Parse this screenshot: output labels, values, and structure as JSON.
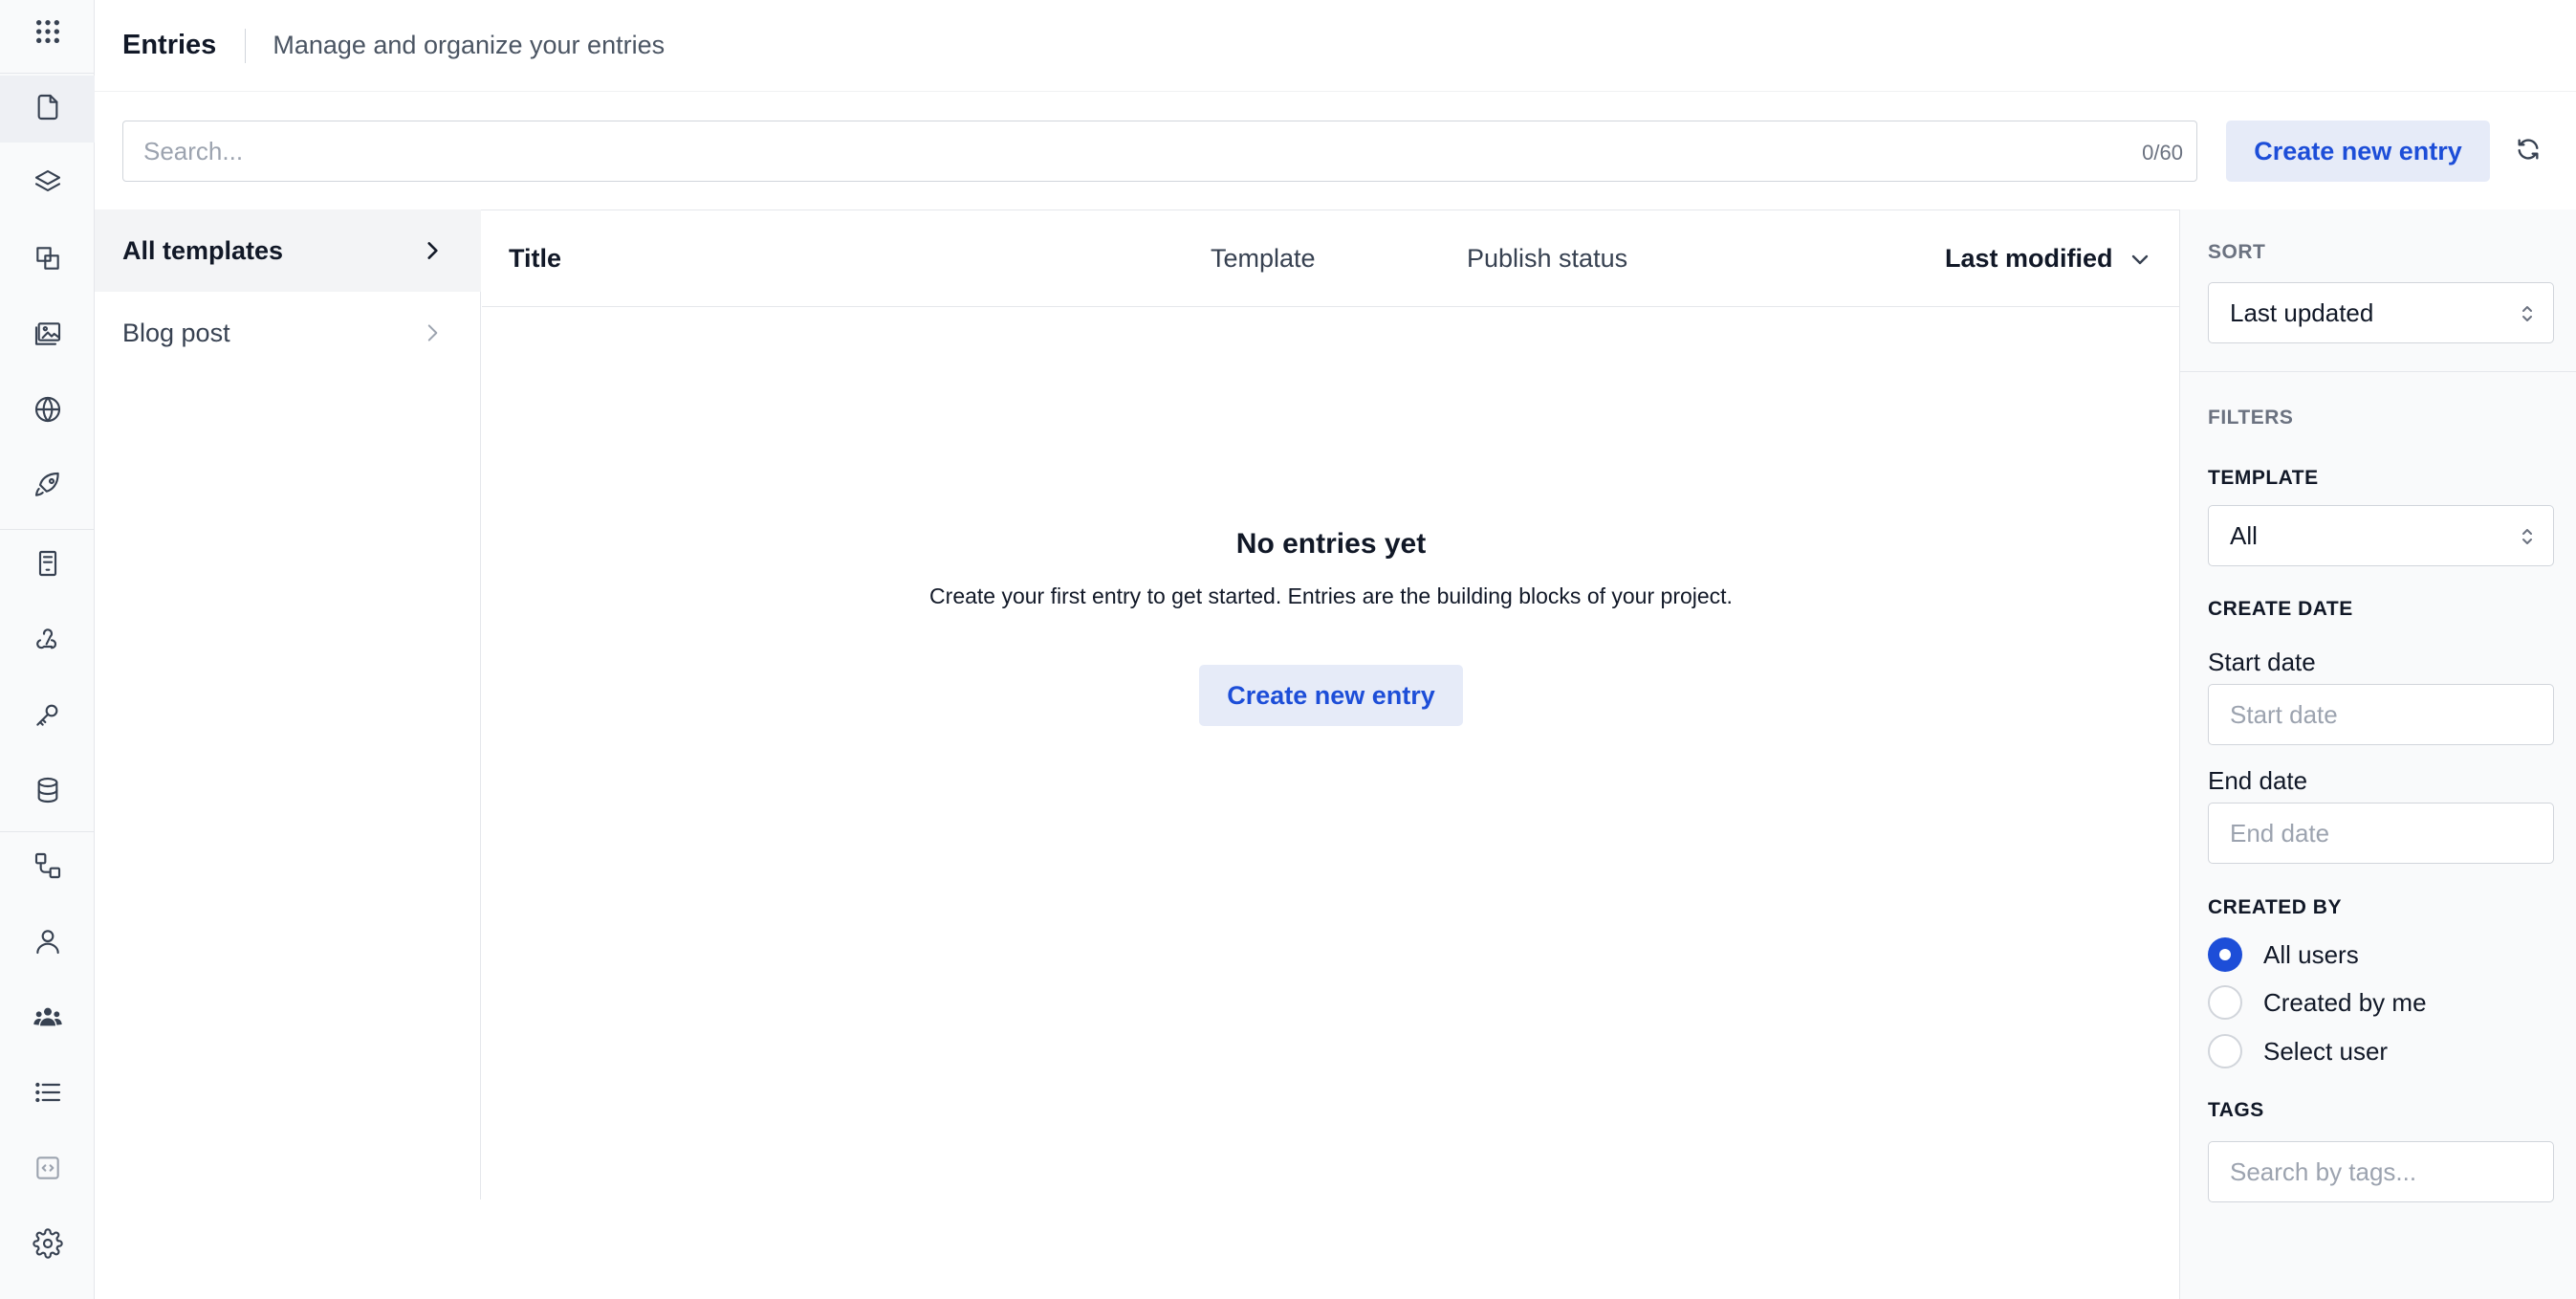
{
  "header": {
    "title": "Entries",
    "subtitle": "Manage and organize your entries"
  },
  "search": {
    "placeholder": "Search...",
    "value": "",
    "counter": "0/60"
  },
  "actions": {
    "create_label": "Create new entry"
  },
  "rail": {
    "items": [
      {
        "icon": "grid-icon"
      },
      {
        "icon": "document-icon",
        "active": true
      },
      {
        "icon": "layers-icon"
      },
      {
        "icon": "shapes-icon"
      },
      {
        "icon": "images-icon"
      },
      {
        "icon": "globe-icon"
      },
      {
        "icon": "rocket-icon"
      },
      {
        "icon": "receipt-icon"
      },
      {
        "icon": "webhook-icon"
      },
      {
        "icon": "key-icon"
      },
      {
        "icon": "database-icon"
      },
      {
        "icon": "workflow-icon"
      },
      {
        "icon": "user-icon"
      },
      {
        "icon": "users-icon"
      },
      {
        "icon": "list-icon"
      },
      {
        "icon": "code-icon"
      },
      {
        "icon": "gear-icon"
      }
    ]
  },
  "templates": {
    "items": [
      {
        "label": "All templates",
        "active": true
      },
      {
        "label": "Blog post",
        "active": false
      }
    ]
  },
  "table": {
    "columns": {
      "title": "Title",
      "template": "Template",
      "status": "Publish status",
      "modified": "Last modified"
    },
    "rows": []
  },
  "empty_state": {
    "heading": "No entries yet",
    "description": "Create your first entry to get started. Entries are the building blocks of your project.",
    "button": "Create new entry"
  },
  "sidebar_right": {
    "sort_label": "SORT",
    "sort_value": "Last updated",
    "filters_label": "FILTERS",
    "template_label": "TEMPLATE",
    "template_value": "All",
    "create_date_label": "CREATE DATE",
    "start_date_label": "Start date",
    "start_date_placeholder": "Start date",
    "end_date_label": "End date",
    "end_date_placeholder": "End date",
    "created_by_label": "CREATED BY",
    "created_by_options": [
      {
        "label": "All users",
        "checked": true
      },
      {
        "label": "Created by me",
        "checked": false
      },
      {
        "label": "Select user",
        "checked": false
      }
    ],
    "tags_label": "TAGS",
    "tags_placeholder": "Search by tags..."
  },
  "colors": {
    "accent": "#1d4ed8",
    "accent_bg": "#e6ebf8",
    "panel_bg": "#f9fafb",
    "border": "#e5e7eb"
  }
}
